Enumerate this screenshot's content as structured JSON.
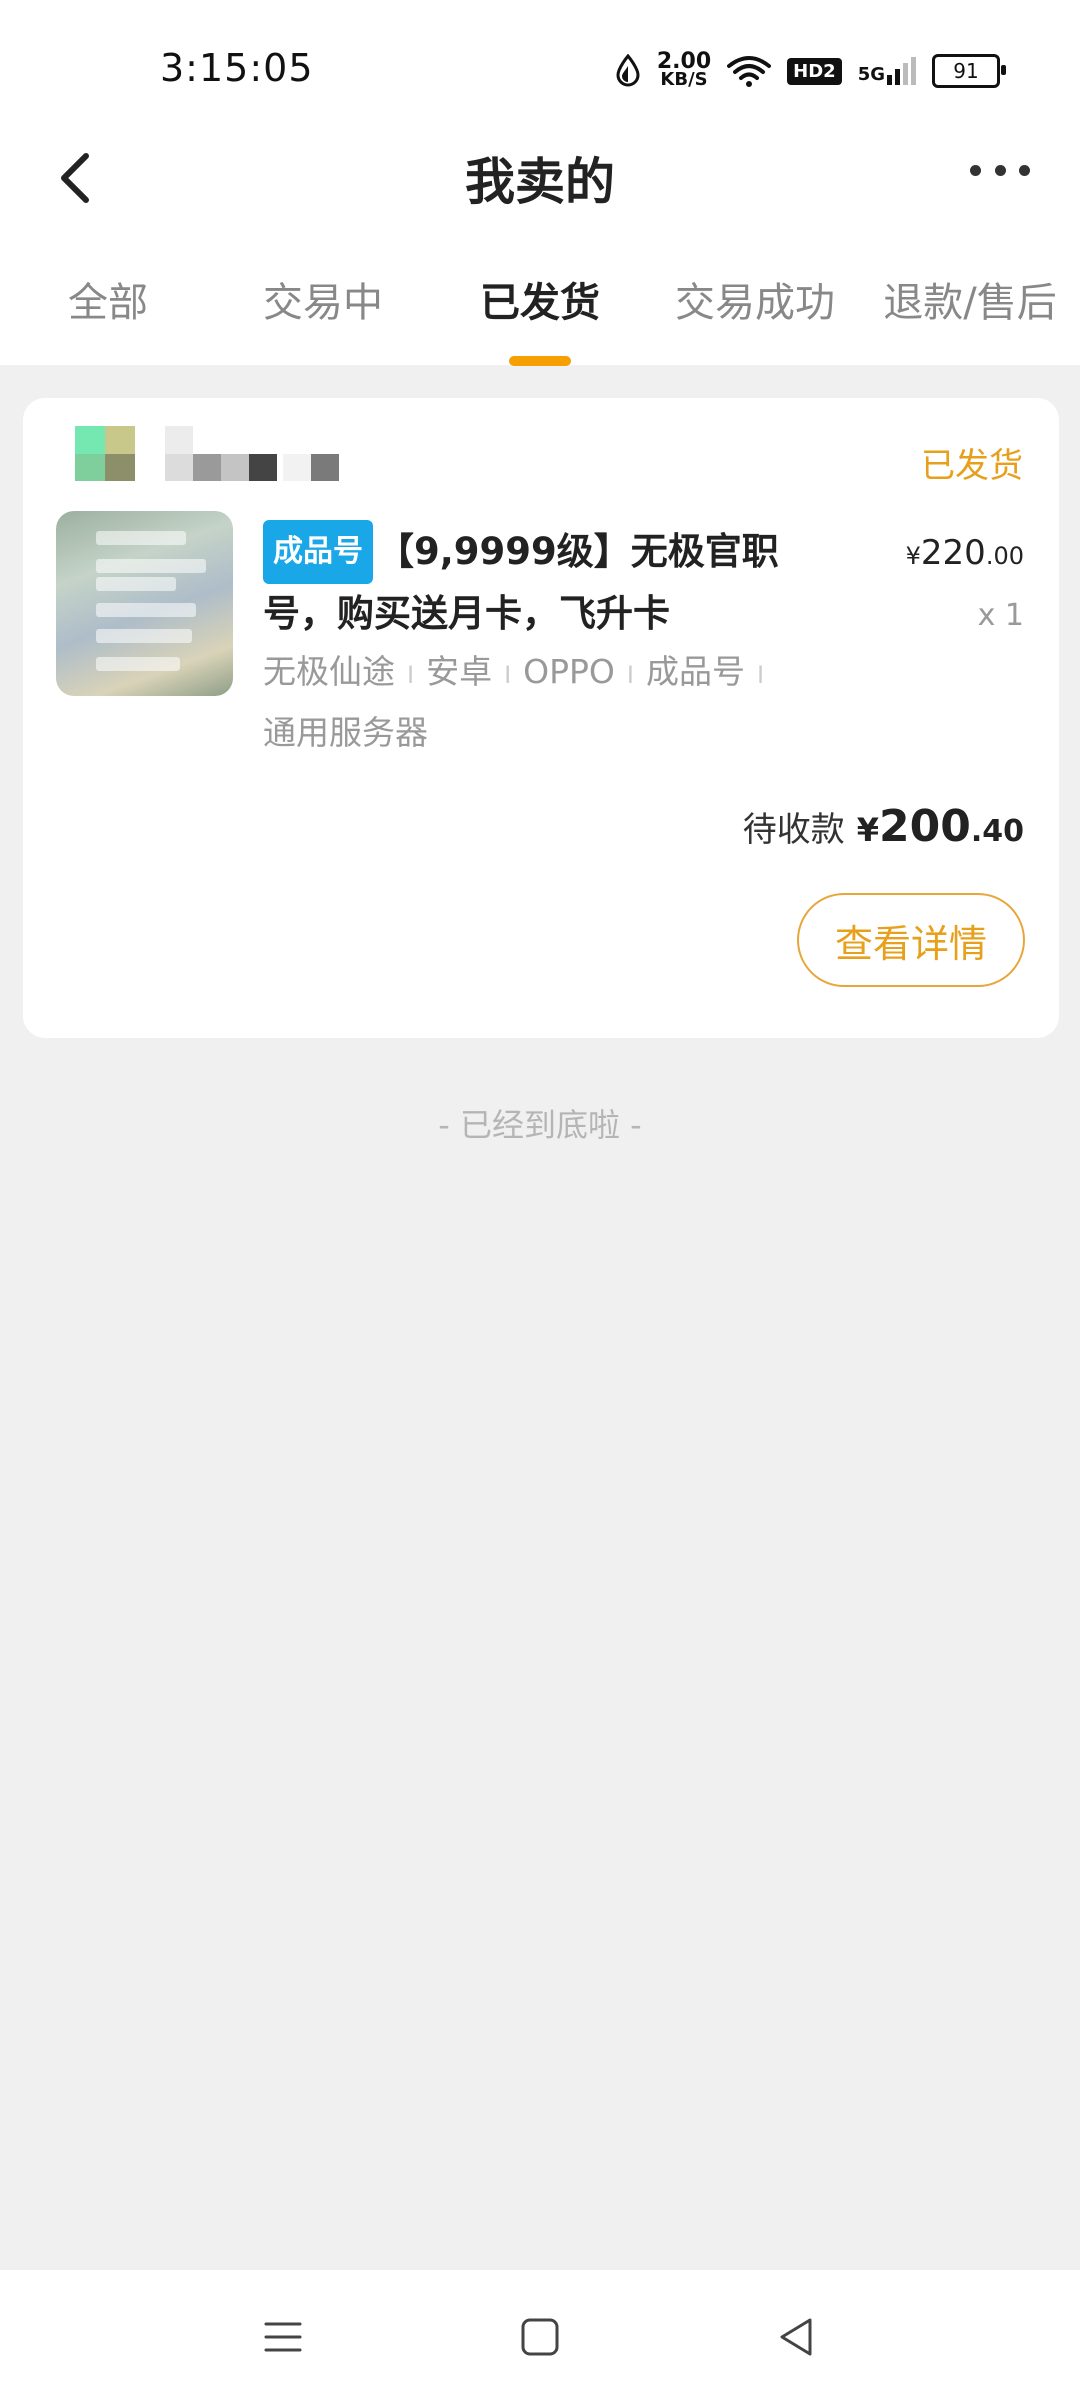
{
  "status_bar": {
    "time": "3:15:05",
    "net_speed_value": "2.00",
    "net_speed_unit": "KB/S",
    "hd_label": "HD2",
    "network_label": "5G",
    "battery": "91"
  },
  "header": {
    "title": "我卖的"
  },
  "tabs": [
    {
      "label": "全部"
    },
    {
      "label": "交易中"
    },
    {
      "label": "已发货"
    },
    {
      "label": "交易成功"
    },
    {
      "label": "退款/售后"
    }
  ],
  "active_tab": "已发货",
  "order": {
    "status": "已发货",
    "tag": "成品号",
    "title": "【9,9999级】无极官职号，购买送月卡，飞升卡",
    "price_symbol": "¥",
    "price_int": "220",
    "price_dec": ".00",
    "quantity": "x 1",
    "attributes": [
      "无极仙途",
      "安卓",
      "OPPO",
      "成品号",
      "通用服务器"
    ],
    "total_label": "待收款",
    "total_symbol": "¥",
    "total_int": "200",
    "total_dec": ".40",
    "detail_button": "查看详情"
  },
  "footer_hint": "- 已经到底啦 -",
  "colors": {
    "accent": "#f5a000",
    "status_text": "#e6a01c",
    "tag_bg": "#1aa7e8",
    "page_bg": "#f0f0f0"
  }
}
